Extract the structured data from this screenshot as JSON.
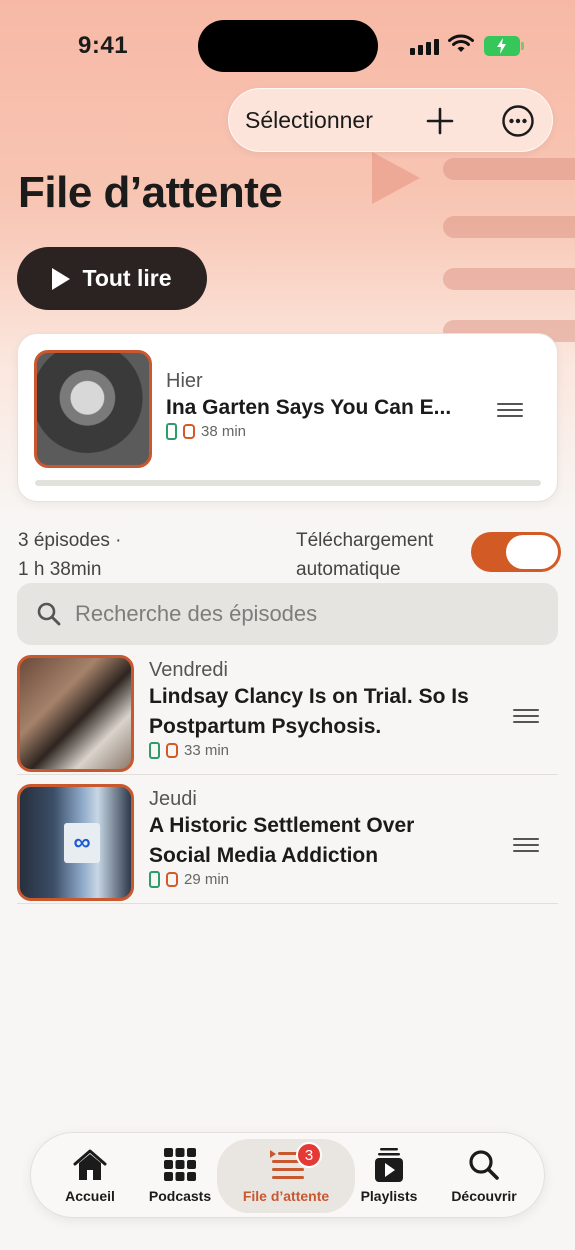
{
  "status_bar": {
    "time": "9:41"
  },
  "header": {
    "select_label": "Sélectionner",
    "title": "File d’attente",
    "play_all_label": "Tout lire"
  },
  "now_playing": {
    "day": "Hier",
    "title": "Ina Garten Says You Can E...",
    "duration": "38 min",
    "progress": 0.0
  },
  "summary": {
    "count_line": "3 épisodes ·",
    "total_line": "1 h 38min",
    "auto_download_line1": "Téléchargement",
    "auto_download_line2": "automatique",
    "auto_download_on": true
  },
  "search": {
    "placeholder": "Recherche des épisodes"
  },
  "episodes": [
    {
      "day": "Vendredi",
      "title_line1": "Lindsay Clancy Is on Trial. So Is",
      "title_line2": "Postpartum Psychosis.",
      "duration": "33 min"
    },
    {
      "day": "Jeudi",
      "title_line1": "A Historic Settlement Over",
      "title_line2": "Social Media Addiction",
      "duration": "29 min"
    }
  ],
  "tabbar": {
    "tabs": [
      {
        "label": "Accueil",
        "icon": "home-icon"
      },
      {
        "label": "Podcasts",
        "icon": "grid-icon"
      },
      {
        "label": "File d’attente",
        "icon": "queue-icon",
        "badge": "3",
        "active": true
      },
      {
        "label": "Playlists",
        "icon": "playlist-icon"
      },
      {
        "label": "Découvrir",
        "icon": "search-icon"
      }
    ]
  },
  "colors": {
    "accent": "#c9582f",
    "toggle_on": "#d25a25",
    "badge": "#e53935"
  }
}
